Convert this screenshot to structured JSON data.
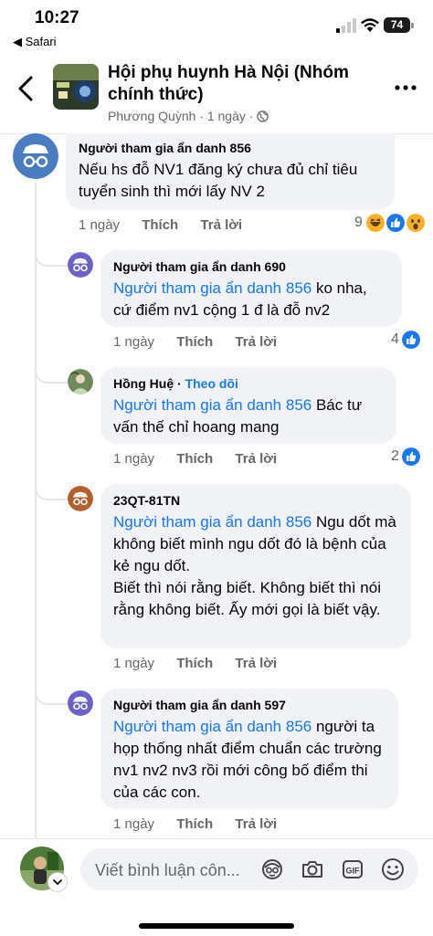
{
  "status_bar": {
    "time": "10:27",
    "back_app": "◀ Safari",
    "battery": "74"
  },
  "header": {
    "title": "Hội phụ huynh Hà Nội (Nhóm chính thức)",
    "author": "Phương Quỳnh",
    "time": "1 ngày",
    "privacy_icon": "globe-icon"
  },
  "comments": [
    {
      "author": "Người tham gia ẩn danh 856",
      "mention": "",
      "text": "Nếu hs đỗ NV1 đăng ký chưa đủ chỉ tiêu tuyển sinh thì mới lấy NV 2",
      "time": "1 ngày",
      "like": "Thích",
      "reply": "Trả lời",
      "reaction_count": "9",
      "reactions": [
        "haha",
        "like",
        "wow"
      ]
    },
    {
      "author": "Người tham gia ẩn danh 690",
      "mention": "Người tham gia ẩn danh 856",
      "text": " ko nha, cứ điểm nv1 cộng 1 đ là đỗ nv2",
      "time": "1 ngày",
      "like": "Thích",
      "reply": "Trả lời",
      "reaction_count": "4",
      "reactions": [
        "like"
      ]
    },
    {
      "author": "Hồng Huệ",
      "follow": "Theo dõi",
      "mention": "Người tham gia ẩn danh 856",
      "text": " Bác tư vấn thế chỉ hoang mang",
      "time": "1 ngày",
      "like": "Thích",
      "reply": "Trả lời",
      "reaction_count": "2",
      "reactions": [
        "like"
      ]
    },
    {
      "author": "23QT-81TN",
      "mention": "Người tham gia ẩn danh 856",
      "text": " Ngu dốt mà không biết mình ngu dốt đó là bệnh của kẻ ngu dốt.\nBiết thì nói rằng biết. Không biết thì nói rằng không biết. Ấy mới gọi là biết vậy.",
      "time": "1 ngày",
      "like": "Thích",
      "reply": "Trả lời"
    },
    {
      "author": "Người tham gia ẩn danh 597",
      "mention": "Người tham gia ẩn danh 856",
      "text": " người ta họp thống nhất điểm chuẩn các trường nv1 nv2 nv3 rồi mới công bố điểm thi của các con.",
      "time": "1 ngày",
      "like": "Thích",
      "reply": "Trả lời"
    }
  ],
  "composer": {
    "placeholder": "Viết bình luận côn...",
    "icons": [
      "avatar-sticker-icon",
      "camera-icon",
      "gif-icon",
      "emoji-icon"
    ]
  },
  "colors": {
    "link": "#1877f2",
    "bubble": "#f0f2f5",
    "muted": "#65676b",
    "anon_avatar": "#4a7dbf",
    "anon_small": "#6b63c7",
    "user_23qt": "#b4602c"
  }
}
